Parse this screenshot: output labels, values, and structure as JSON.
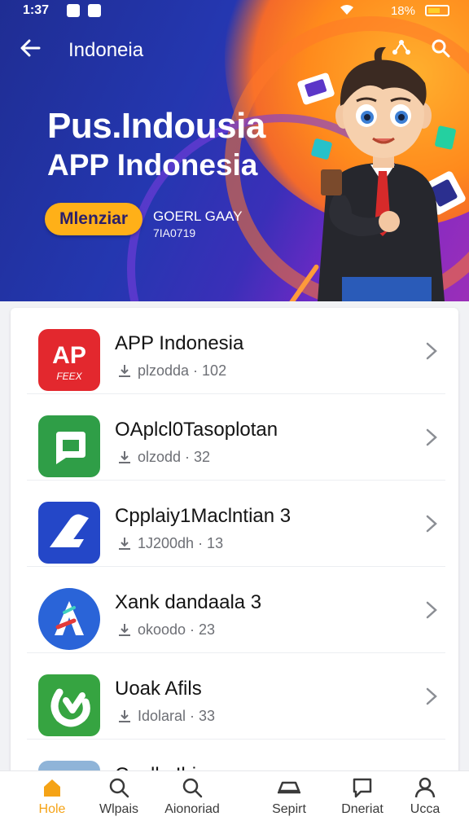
{
  "status_bar": {
    "time": "1:37",
    "battery": "18%"
  },
  "app_bar": {
    "title": "Indoneia"
  },
  "hero": {
    "headline_1": "Pus.Indousia",
    "headline_2": "APP Indonesia",
    "button_label": "Mlenziar",
    "sub_line_1": "GOERL GAAY",
    "sub_line_2": "7IA0719"
  },
  "apps": [
    {
      "name": "APP Indonesia",
      "meta": "plzodda · 102",
      "icon": "apex-red-app-icon",
      "icon_text": "AP",
      "icon_caption": "FEEX",
      "color": "#e3282e"
    },
    {
      "name": "OAplcl0Tasoplotan",
      "meta": "olzodd · 32",
      "icon": "green-chat-app-icon",
      "color": "#2f9e47"
    },
    {
      "name": "Cpplaiy1Maclntian 3",
      "meta": "1J200dh · 13",
      "icon": "blue-arrow-app-icon",
      "color": "#2447c8"
    },
    {
      "name": "Xank dandaala 3",
      "meta": "okoodo · 23",
      "icon": "letter-a-app-icon",
      "color": "#2a64d8"
    },
    {
      "name": "Uoak Afils",
      "meta": "Idolaral · 33",
      "icon": "green-refresh-app-icon",
      "color": "#36a441"
    },
    {
      "name": "Conlla Ihin",
      "meta": "",
      "icon": "light-blue-app-icon",
      "color": "#8fb4d8"
    }
  ],
  "bottom_nav": [
    {
      "label": "Hole",
      "icon": "home-icon",
      "active": true
    },
    {
      "label": "Wlpais",
      "icon": "search-icon",
      "active": false
    },
    {
      "label": "Aionoriad",
      "icon": "search-icon",
      "active": false
    },
    {
      "label": "Sepirt",
      "icon": "car-icon",
      "active": false
    },
    {
      "label": "Dneriat",
      "icon": "chat-icon",
      "active": false
    },
    {
      "label": "Ucca",
      "icon": "profile-icon",
      "active": false
    }
  ],
  "colors": {
    "accent": "#f5a316",
    "hero_blue": "#2437b0",
    "hero_orange": "#ff8a1c"
  }
}
